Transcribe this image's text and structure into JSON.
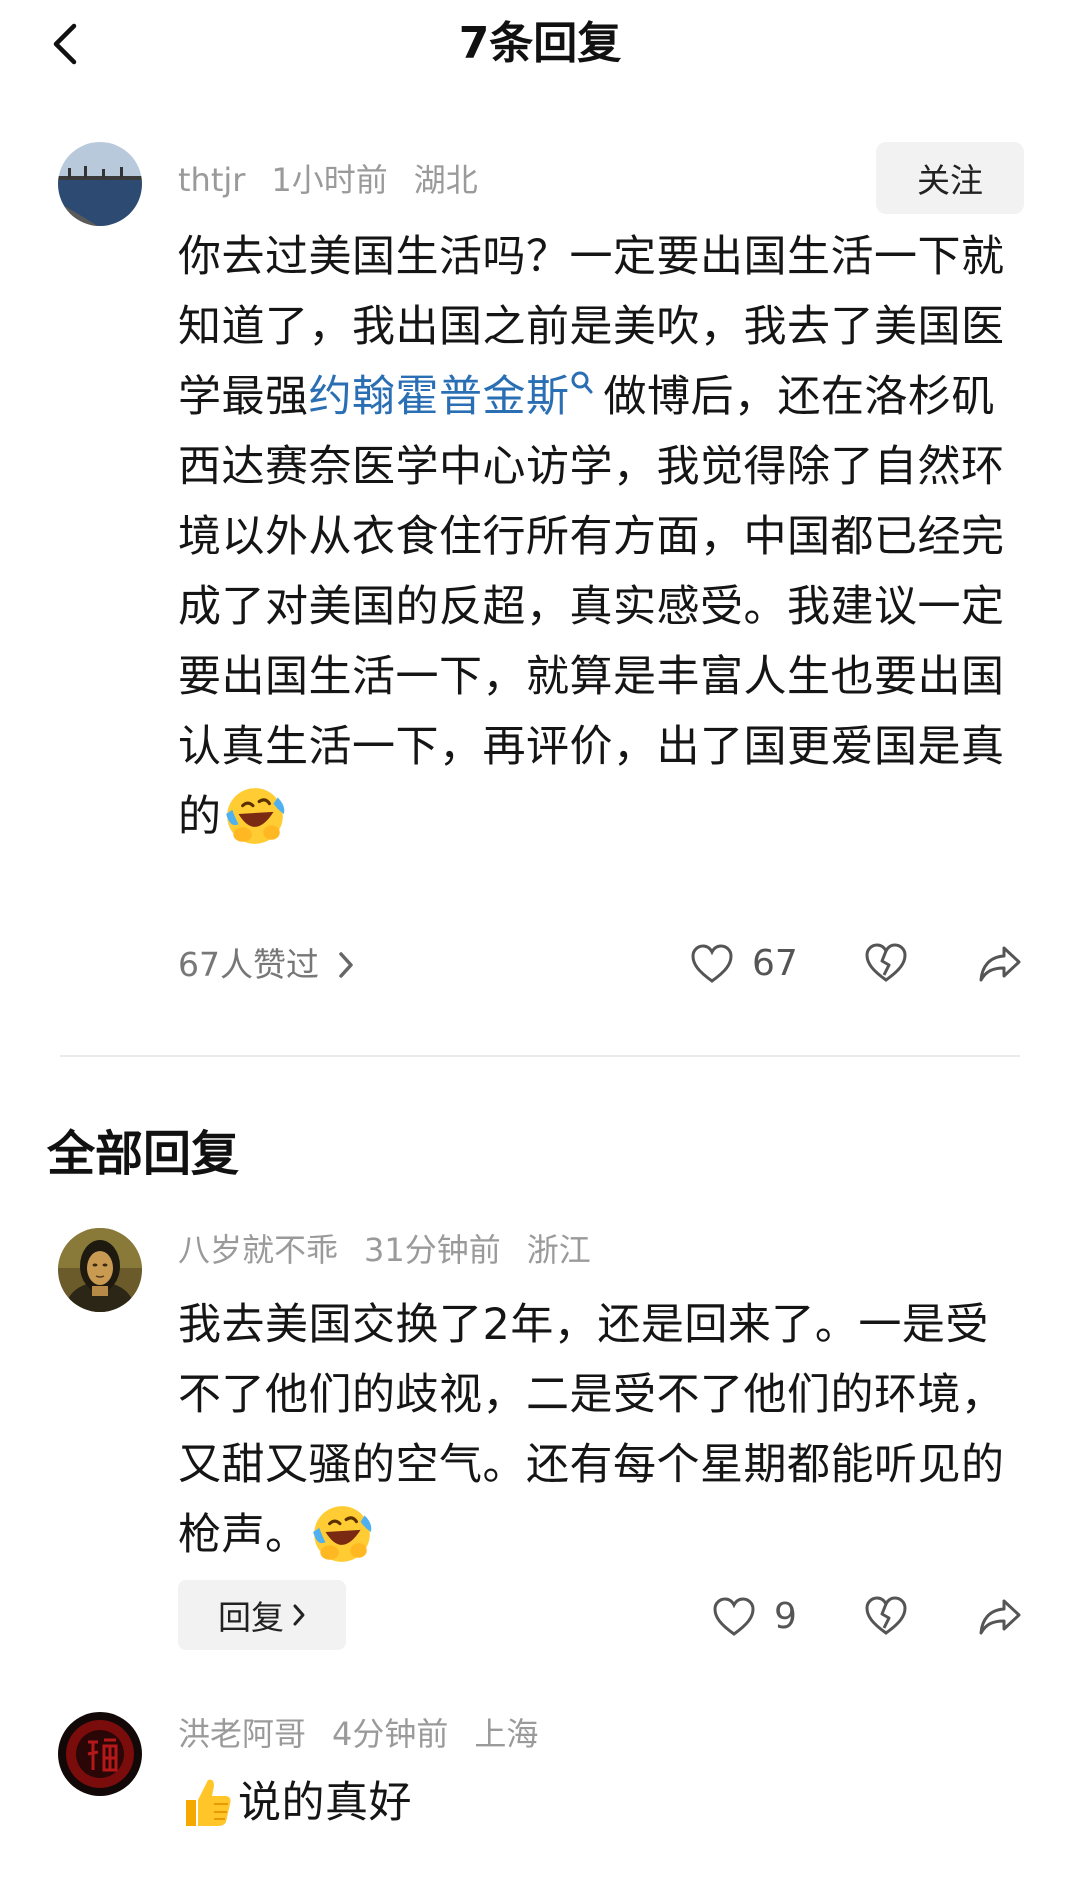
{
  "header": {
    "title": "7条回复"
  },
  "main_comment": {
    "user": "thtjr",
    "time": "1小时前",
    "location": "湖北",
    "follow_label": "关注",
    "text_before_link": "你去过美国生活吗？一定要出国生活一下就知道了，我出国之前是美吹，我去了美国医学最强",
    "link_text": "约翰霍普金斯",
    "text_after_link": "做博后，还在洛杉矶西达赛奈医学中心访学，我觉得除了自然环境以外从衣食住行所有方面，中国都已经完成了对美国的反超，真实感受。我建议一定要出国生活一下，就算是丰富人生也要出国认真生活一下，再评价，出了国更爱国是真的",
    "emoji": "laughing-crying-emoji",
    "liked_by": "67人赞过",
    "like_count": "67"
  },
  "section": {
    "title": "全部回复"
  },
  "replies": [
    {
      "user": "八岁就不乖",
      "time": "31分钟前",
      "location": "浙江",
      "text": "我去美国交换了2年，还是回来了。一是受不了他们的歧视，二是受不了他们的环境，又甜又骚的空气。还有每个星期都能听见的枪声。",
      "emoji": "laughing-crying-emoji",
      "reply_label": "回复",
      "like_count": "9"
    },
    {
      "user": "洪老阿哥",
      "time": "4分钟前",
      "location": "上海",
      "emoji": "thumbs-up-emoji",
      "text": "说的真好"
    }
  ],
  "colors": {
    "link": "#2a6fb4",
    "meta": "#9a9a9a",
    "button_bg": "#f2f2f2"
  }
}
